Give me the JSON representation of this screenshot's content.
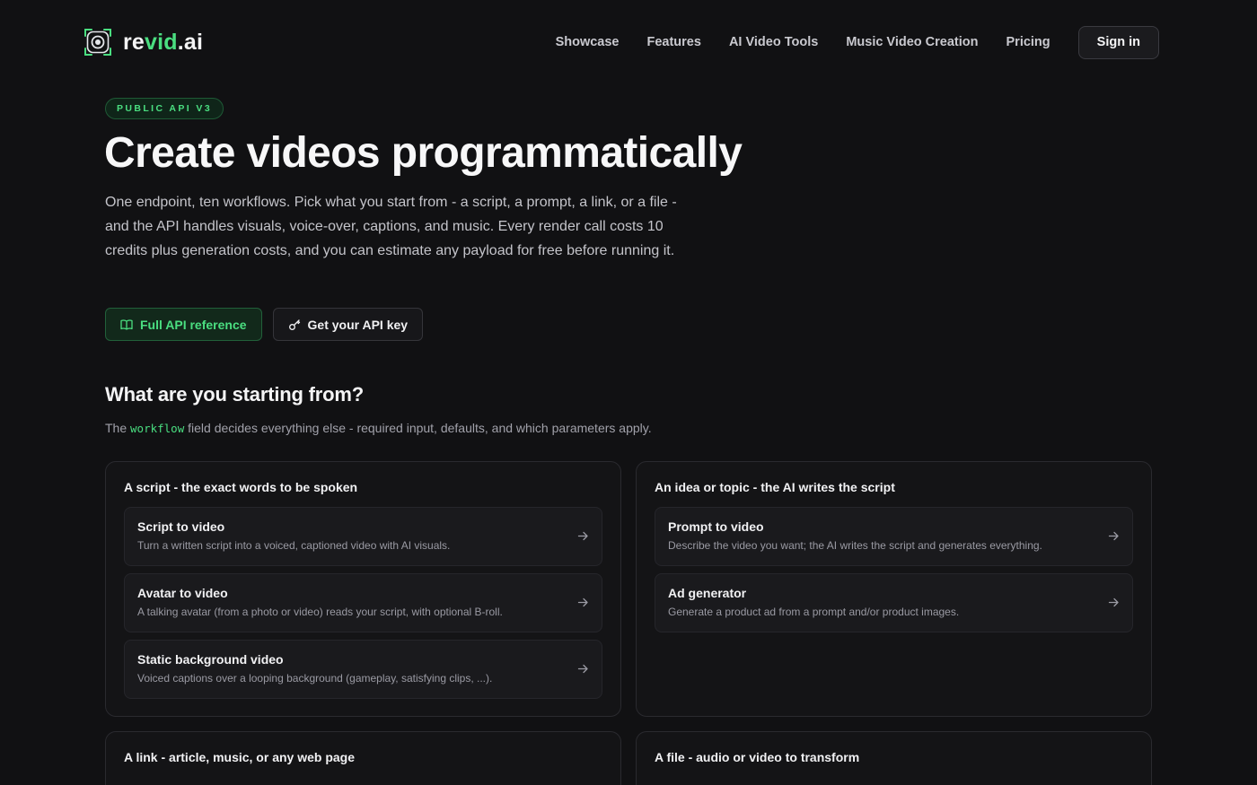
{
  "brand": {
    "name_prefix": "re",
    "name_accent": "vid",
    "name_suffix": ".ai",
    "accent_color": "#4ade80"
  },
  "nav": {
    "items": [
      {
        "label": "Showcase"
      },
      {
        "label": "Features"
      },
      {
        "label": "AI Video Tools"
      },
      {
        "label": "Music Video Creation"
      },
      {
        "label": "Pricing"
      }
    ],
    "sign_in": "Sign in"
  },
  "hero": {
    "badge": "PUBLIC API V3",
    "title": "Create videos programmatically",
    "description": "One endpoint, ten workflows. Pick what you start from - a script, a prompt, a link, or a file - and the API handles visuals, voice-over, captions, and music. Every render call costs 10 credits plus generation costs, and you can estimate any payload for free before running it.",
    "primary_button": {
      "label": "Full API reference",
      "icon": "book-icon"
    },
    "secondary_button": {
      "label": "Get your API key",
      "icon": "key-icon"
    }
  },
  "section": {
    "title": "What are you starting from?",
    "subtitle_pre": "The ",
    "subtitle_code": "workflow",
    "subtitle_post": " field decides everything else - required input, defaults, and which parameters apply."
  },
  "groups": [
    {
      "title": "A script - the exact words to be spoken",
      "items": [
        {
          "name": "Script to video",
          "description": "Turn a written script into a voiced, captioned video with AI visuals."
        },
        {
          "name": "Avatar to video",
          "description": "A talking avatar (from a photo or video) reads your script, with optional B-roll."
        },
        {
          "name": "Static background video",
          "description": "Voiced captions over a looping background (gameplay, satisfying clips, ...)."
        }
      ]
    },
    {
      "title": "An idea or topic - the AI writes the script",
      "items": [
        {
          "name": "Prompt to video",
          "description": "Describe the video you want; the AI writes the script and generates everything."
        },
        {
          "name": "Ad generator",
          "description": "Generate a product ad from a prompt and/or product images."
        }
      ]
    },
    {
      "title": "A link - article, music, or any web page",
      "items": []
    },
    {
      "title": "A file - audio or video to transform",
      "items": []
    }
  ]
}
